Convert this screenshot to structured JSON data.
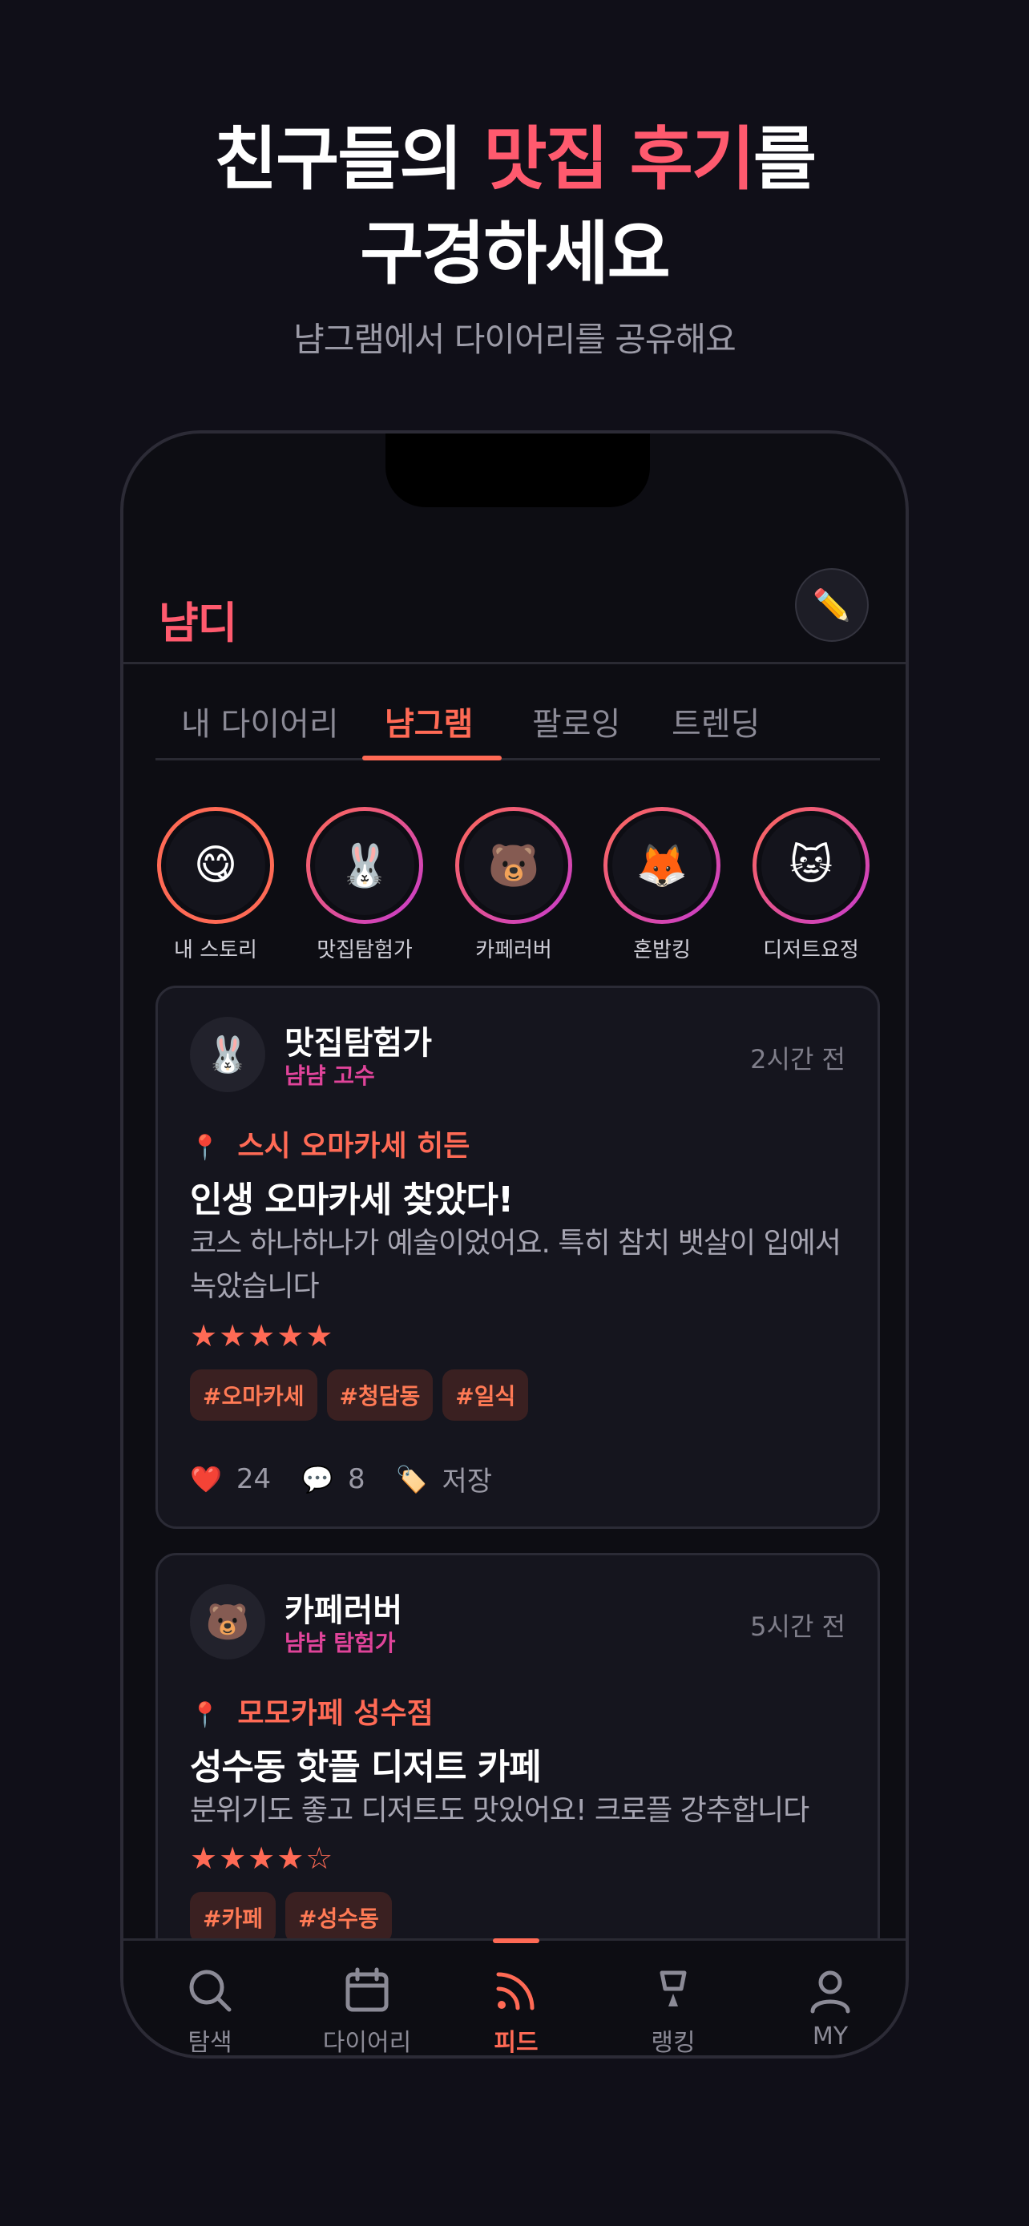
{
  "hero": {
    "line1_pre": "친구들의 ",
    "line1_accent": "맛집 후기",
    "line1_post": "를",
    "line2": "구경하세요",
    "subtitle": "냠그램에서 다이어리를 공유해요"
  },
  "app": {
    "brand": "냠디",
    "write_icon": "✏️"
  },
  "tabs": [
    "내 다이어리",
    "냠그램",
    "팔로잉",
    "트렌딩"
  ],
  "active_tab": "냠그램",
  "stories": [
    {
      "name": "내 스토리",
      "emoji": "😋"
    },
    {
      "name": "맛집탐험가",
      "emoji": "🐰"
    },
    {
      "name": "카페러버",
      "emoji": "🐻"
    },
    {
      "name": "혼밥킹",
      "emoji": "🦊"
    },
    {
      "name": "디저트요정",
      "emoji": "🐱"
    }
  ],
  "posts": [
    {
      "avatar": "🐰",
      "user": "맛집탐험가",
      "level": "냠냠 고수",
      "ago": "2시간 전",
      "place": "스시 오마카세 히든",
      "title": "인생 오마카세 찾았다!",
      "body": "코스 하나하나가 예술이었어요. 특히 참치 뱃살이 입에서 녹았습니다",
      "stars": "★★★★★",
      "rating": 5,
      "tags": [
        "#오마카세",
        "#청담동",
        "#일식"
      ],
      "likes": "24",
      "comments": "8",
      "save_label": "저장"
    },
    {
      "avatar": "🐻",
      "user": "카페러버",
      "level": "냠냠 탐험가",
      "ago": "5시간 전",
      "place": "모모카페 성수점",
      "title": "성수동 핫플 디저트 카페",
      "body": "분위기도 좋고 디저트도 맛있어요! 크로플 강추합니다",
      "stars": "★★★★☆",
      "rating": 4,
      "tags": [
        "#카페",
        "#성수동"
      ]
    }
  ],
  "nav": [
    {
      "label": "탐색",
      "icon": "search-icon"
    },
    {
      "label": "다이어리",
      "icon": "calendar-icon"
    },
    {
      "label": "피드",
      "icon": "feed-icon"
    },
    {
      "label": "랭킹",
      "icon": "trophy-icon"
    },
    {
      "label": "MY",
      "icon": "profile-icon"
    }
  ],
  "active_nav": "피드",
  "colors": {
    "accent": "#ff6a55",
    "pink": "#e0449a",
    "background": "#100f18"
  }
}
